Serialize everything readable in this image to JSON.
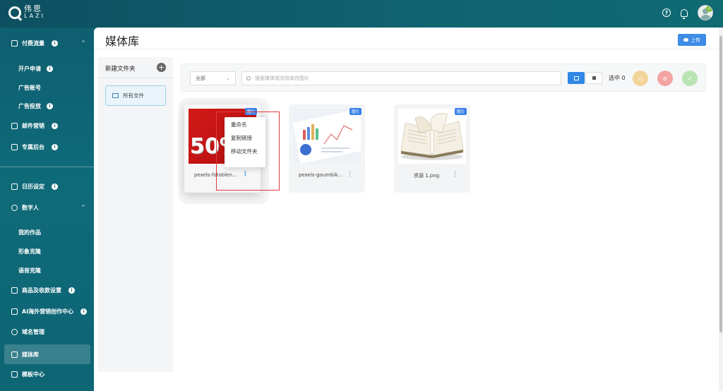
{
  "brand": {
    "cn": "伟思",
    "en": "LAZI"
  },
  "sidebar": {
    "groups": [
      {
        "label": "付费流量",
        "info": "i"
      },
      {
        "label": "邮件营销",
        "info": "i"
      },
      {
        "label": "专属后台",
        "info": "i"
      },
      {
        "label": "日历设定",
        "info": "i"
      },
      {
        "label": "数字人"
      },
      {
        "label": "商品及收款设置",
        "info": "i"
      },
      {
        "label": "AI海外营销创作中心",
        "info": "i"
      },
      {
        "label": "域名管理"
      },
      {
        "label": "媒体库"
      },
      {
        "label": "模板中心"
      }
    ],
    "paid_sub": [
      "开户申请",
      "广告账号",
      "广告投放"
    ],
    "digital_sub": [
      "我的作品",
      "形象克隆",
      "语音克隆"
    ],
    "chevrons": {
      "up": "^"
    }
  },
  "main": {
    "title": "媒体库",
    "upload": "上传",
    "folders": {
      "new_folder": "新建文件夹",
      "plus": "+",
      "all_files": "所有文件"
    },
    "toolbar": {
      "filter": "全部",
      "filter_caret": "⌄",
      "search_placeholder": "搜索媒体或浏览库存图片",
      "selected": "选中 0"
    },
    "cards": [
      {
        "tag": "图片",
        "name": "pexels-fotoblen...",
        "dots": "⋮"
      },
      {
        "tag": "图片",
        "name": "pexels-goumbik...",
        "dots": "⋮"
      },
      {
        "tag": "图片",
        "name": "资源 1.png",
        "dots": "⋮"
      }
    ],
    "context_menu": [
      "重命名",
      "复制链接",
      "移动文件夹"
    ]
  },
  "colors": {
    "primary": "#2f86e6",
    "sidebar": "#0e5f70",
    "highlight": "#e23b3b"
  }
}
